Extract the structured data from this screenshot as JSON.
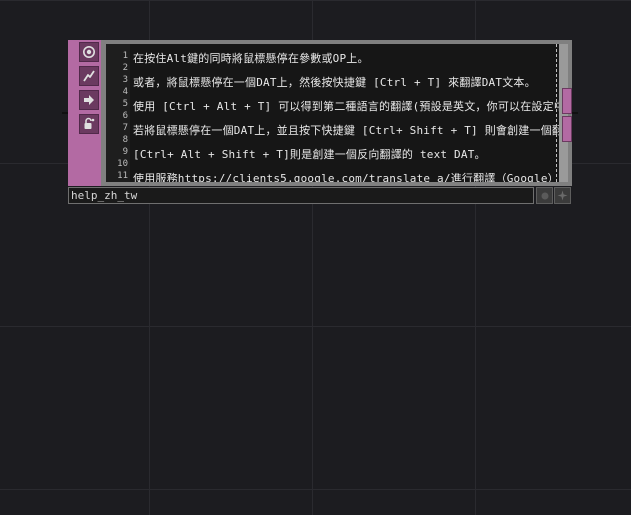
{
  "node": {
    "name": "help_zh_tw",
    "sidebar_icons": [
      "viewer-toggle-icon",
      "cook-flag-icon",
      "export-arrow-icon",
      "lock-icon"
    ],
    "lines": [
      {
        "num": "1",
        "text": "在按住Alt鍵的同時將鼠標懸停在參數或OP上。"
      },
      {
        "num": "2",
        "text": ""
      },
      {
        "num": "3",
        "text": "或者，將鼠標懸停在一個DAT上，然後按快捷鍵 [Ctrl + T] 來翻譯DAT文本。"
      },
      {
        "num": "4",
        "text": ""
      },
      {
        "num": "5",
        "text": "使用 [Ctrl + Alt + T] 可以得到第二種語言的翻譯(預設是英文，你可以在設定中更改)。"
      },
      {
        "num": "6",
        "text": ""
      },
      {
        "num": "7",
        "text": "若將鼠標懸停在一個DAT上，並且按下快捷鍵 [Ctrl+ Shift + T] 則會創建一個翻譯後的 text DAT。"
      },
      {
        "num": "8",
        "text": ""
      },
      {
        "num": "9",
        "text": "[Ctrl+ Alt + Shift + T]則是創建一個反向翻譯的 text DAT。"
      },
      {
        "num": "10",
        "text": ""
      },
      {
        "num": "11",
        "text": "使用服務https://clients5.google.com/translate_a/進行翻譯（Google）"
      }
    ]
  },
  "colors": {
    "canvas": "#1c1c20",
    "node_accent": "#b36aa3",
    "node_frame": "#808080",
    "text_bg": "#161616"
  }
}
